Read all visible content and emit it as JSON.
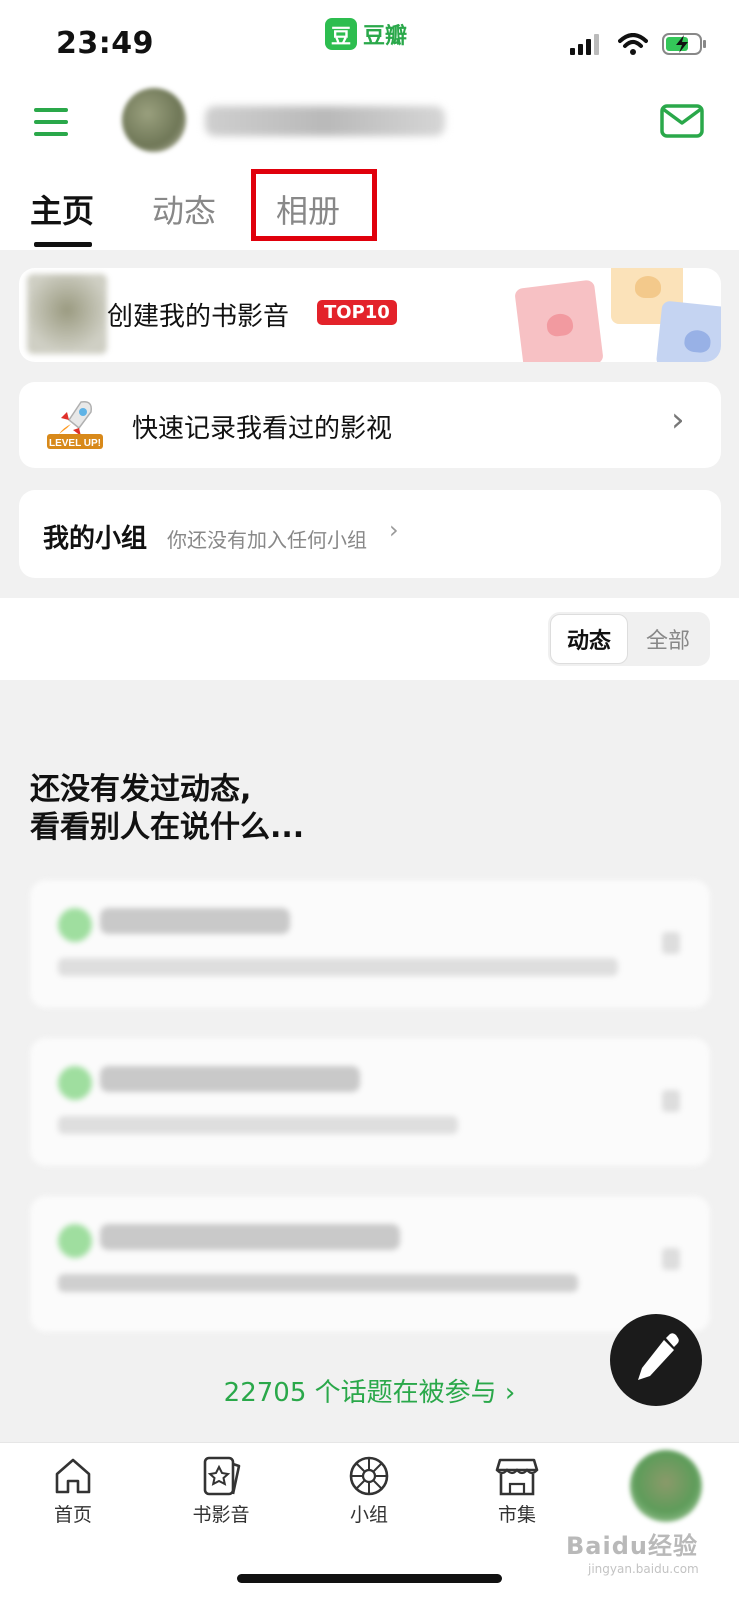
{
  "status_bar": {
    "time": "23:49",
    "app_name": "豆瓣",
    "app_logo_glyph": "豆"
  },
  "header": {
    "icons": [
      "menu-icon",
      "mail-icon"
    ]
  },
  "tabs": [
    {
      "label": "主页"
    },
    {
      "label": "动态"
    },
    {
      "label": "相册"
    }
  ],
  "top10_card": {
    "title": "创建我的书影音",
    "badge": "TOP10"
  },
  "record_card": {
    "title": "快速记录我看过的影视",
    "icon_text": "LEVEL UP!"
  },
  "groups_card": {
    "title": "我的小组",
    "subtitle": "你还没有加入任何小组"
  },
  "filter": {
    "active": "动态",
    "inactive": "全部"
  },
  "empty_state": {
    "line1": "还没有发过动态,",
    "line2": "看看别人在说什么..."
  },
  "topics_link": "22705 个话题在被参与",
  "bottom_nav": [
    {
      "label": "首页",
      "icon": "home-icon"
    },
    {
      "label": "书影音",
      "icon": "star-card-icon"
    },
    {
      "label": "小组",
      "icon": "group-ball-icon"
    },
    {
      "label": "市集",
      "icon": "store-icon"
    }
  ],
  "watermark": {
    "text": "Baidu经验",
    "sub": "jingyan.baidu.com"
  },
  "colors": {
    "brand_green": "#2aa84a",
    "highlight_red": "#e0000c",
    "badge_red": "#e3222a"
  }
}
